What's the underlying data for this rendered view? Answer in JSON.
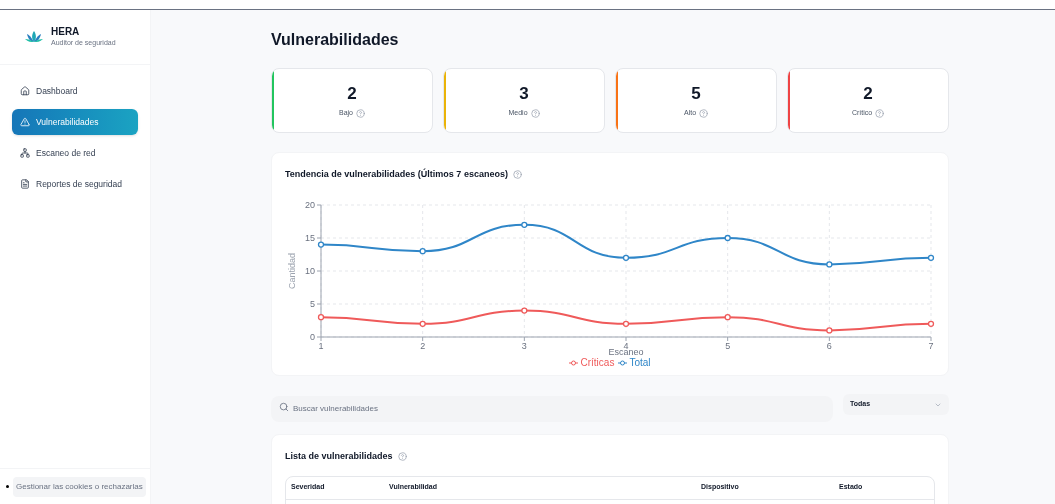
{
  "brand": {
    "name": "HERA",
    "subtitle": "Auditor de seguridad"
  },
  "nav": [
    {
      "label": "Dashboard",
      "kind": "home",
      "selected": false
    },
    {
      "label": "Vulnerabilidades",
      "kind": "alert",
      "selected": true
    },
    {
      "label": "Escaneo de red",
      "kind": "network",
      "selected": false
    },
    {
      "label": "Reportes de seguridad",
      "kind": "report",
      "selected": false
    }
  ],
  "cookie_button": "Gestionar las cookies o rechazarlas",
  "title": "Vulnerabilidades",
  "stats": [
    {
      "value": "2",
      "label": "Bajo",
      "color": "#22c55e"
    },
    {
      "value": "3",
      "label": "Medio",
      "color": "#eab308"
    },
    {
      "value": "5",
      "label": "Alto",
      "color": "#f97316"
    },
    {
      "value": "2",
      "label": "Crítico",
      "color": "#ef4444"
    }
  ],
  "trend": {
    "title": "Tendencia de vulnerabilidades (Últimos 7 escaneos)",
    "chart_data": {
      "type": "line",
      "xlabel": "Escaneo",
      "ylabel": "Cantidad",
      "x": [
        1,
        2,
        3,
        4,
        5,
        6,
        7
      ],
      "xlim": [
        1,
        7
      ],
      "ylim": [
        0,
        20
      ],
      "grid": true,
      "legend": true,
      "yticks": [
        0,
        5,
        10,
        15,
        20
      ],
      "xticks": [
        1,
        2,
        3,
        4,
        5,
        6,
        7
      ],
      "series": [
        {
          "name": "Críticas",
          "color": "#ef5a5a",
          "marker": "circle",
          "values": [
            3,
            2,
            4,
            2,
            3,
            1,
            2
          ]
        },
        {
          "name": "Total",
          "color": "#2f86c8",
          "marker": "circle",
          "values": [
            14,
            13,
            17,
            12,
            15,
            11,
            12
          ]
        }
      ]
    }
  },
  "search": {
    "placeholder": "Buscar vulnerabilidades"
  },
  "filter": {
    "value": "Todas"
  },
  "list": {
    "title": "Lista de vulnerabilidades",
    "columns": [
      "Severidad",
      "Vulnerabilidad",
      "Dispositivo",
      "Estado"
    ]
  }
}
